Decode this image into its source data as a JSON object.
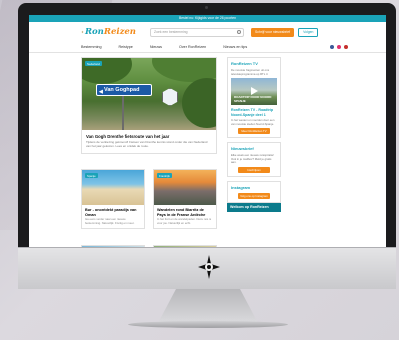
{
  "site": {
    "announcement": "Bestel nu: Kijkgids voor de 26 poorten",
    "logo_text": "RonReizen",
    "search_placeholder": "Zoek een bestemming",
    "button_primary": "Schrijf voor nieuwsbrief",
    "button_secondary": "Volgen",
    "nav": [
      "Bestemming",
      "Reistype",
      "Nieuws",
      "Over RonReizen",
      "Nieuws en tips"
    ],
    "social_colors": [
      "#3b5998",
      "#e1306c",
      "#c4302b"
    ]
  },
  "featured": {
    "tag": "Nederland",
    "sign_text": "Van Goghpad",
    "title": "Van Gogh Drenthe fietsroute van het jaar",
    "excerpt": "Tijdens de verkiezing gekroond! Fietsen van Drenthe kennis stond onder die van Nederland van het jaar gekozen. Lees en ontdek de route."
  },
  "cards": [
    {
      "tag": "Spanje",
      "title": "Bur - onontdekt paradijs van Oman",
      "excerpt": "Ga eens verder naar een nieuwe bestemming. Natuurlijk. Fruitig en meer."
    },
    {
      "tag": "Frankrijk",
      "title": "Wandelen rond Biarritz de Pays in de Franse Ardèche",
      "excerpt": "In het Fort en de wandelpaden. Deze reis is voor jou. Natuurlijk en echt."
    }
  ],
  "sidebar": {
    "tv_title": "RonReizen TV",
    "tv_intro": "De mooiste fragmenten uit ons televisieprogramma op RTL 4",
    "tv_caption": "ROADTRIP DOOR NOORD SPANJE",
    "tv_episode": "RonReizen TV - Roadtrip Noord-Spanje deel 1",
    "tv_excerpt": "In het westen en noorden door een van mooiste steden Noord-Spanje.",
    "tv_button": "Meer RonReizen TV",
    "newsletter_title": "Nieuwsbrief",
    "newsletter_text": "Elke week een nieuwe reisspiratie! Ook in je mailbox? Meld je gratis aan.",
    "newsletter_button": "Inschrijven",
    "instagram_title": "Instagram",
    "instagram_button": "Volg ons op Instagram",
    "welcome_title": "Welkom op RonReizen"
  }
}
